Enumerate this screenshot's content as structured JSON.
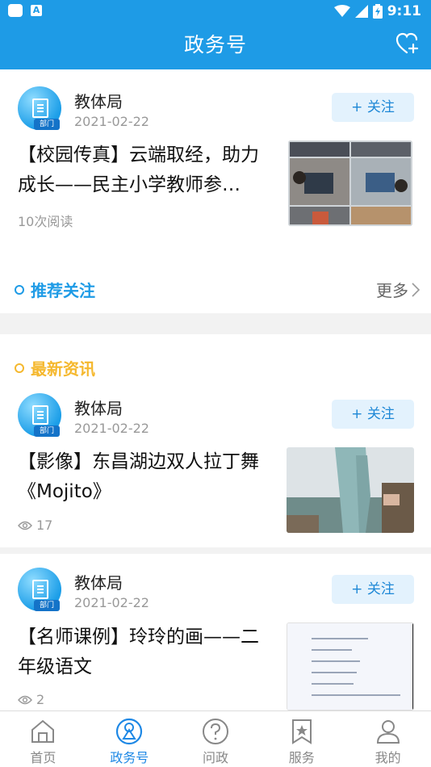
{
  "status_bar": {
    "time": "9:11"
  },
  "header": {
    "title": "政务号"
  },
  "followed": {
    "account": "教体局",
    "date": "2021-02-22",
    "follow_label": "+ 关注",
    "avatar_tag": "部门",
    "headline": "【校园传真】云端取经，助力成长——民主小学教师参…",
    "reads": "10次阅读"
  },
  "recommend": {
    "label": "推荐关注",
    "more": "更多"
  },
  "news": {
    "label": "最新资讯",
    "items": [
      {
        "account": "教体局",
        "date": "2021-02-22",
        "follow_label": "+ 关注",
        "avatar_tag": "部门",
        "headline": "【影像】东昌湖边双人拉丁舞《Mojito》",
        "views": "17"
      },
      {
        "account": "教体局",
        "date": "2021-02-22",
        "follow_label": "+ 关注",
        "avatar_tag": "部门",
        "headline": "【名师课例】玲玲的画——二年级语文",
        "views": "2"
      }
    ]
  },
  "nav": {
    "items": [
      {
        "label": "首页",
        "icon": "home-icon"
      },
      {
        "label": "政务号",
        "icon": "gov-account-icon"
      },
      {
        "label": "问政",
        "icon": "question-icon"
      },
      {
        "label": "服务",
        "icon": "bookmark-star-icon"
      },
      {
        "label": "我的",
        "icon": "user-icon"
      }
    ],
    "active": 1
  },
  "colors": {
    "primary": "#1e9be6",
    "accent_orange": "#f5b82e",
    "follow_bg": "#e3f2fd"
  }
}
